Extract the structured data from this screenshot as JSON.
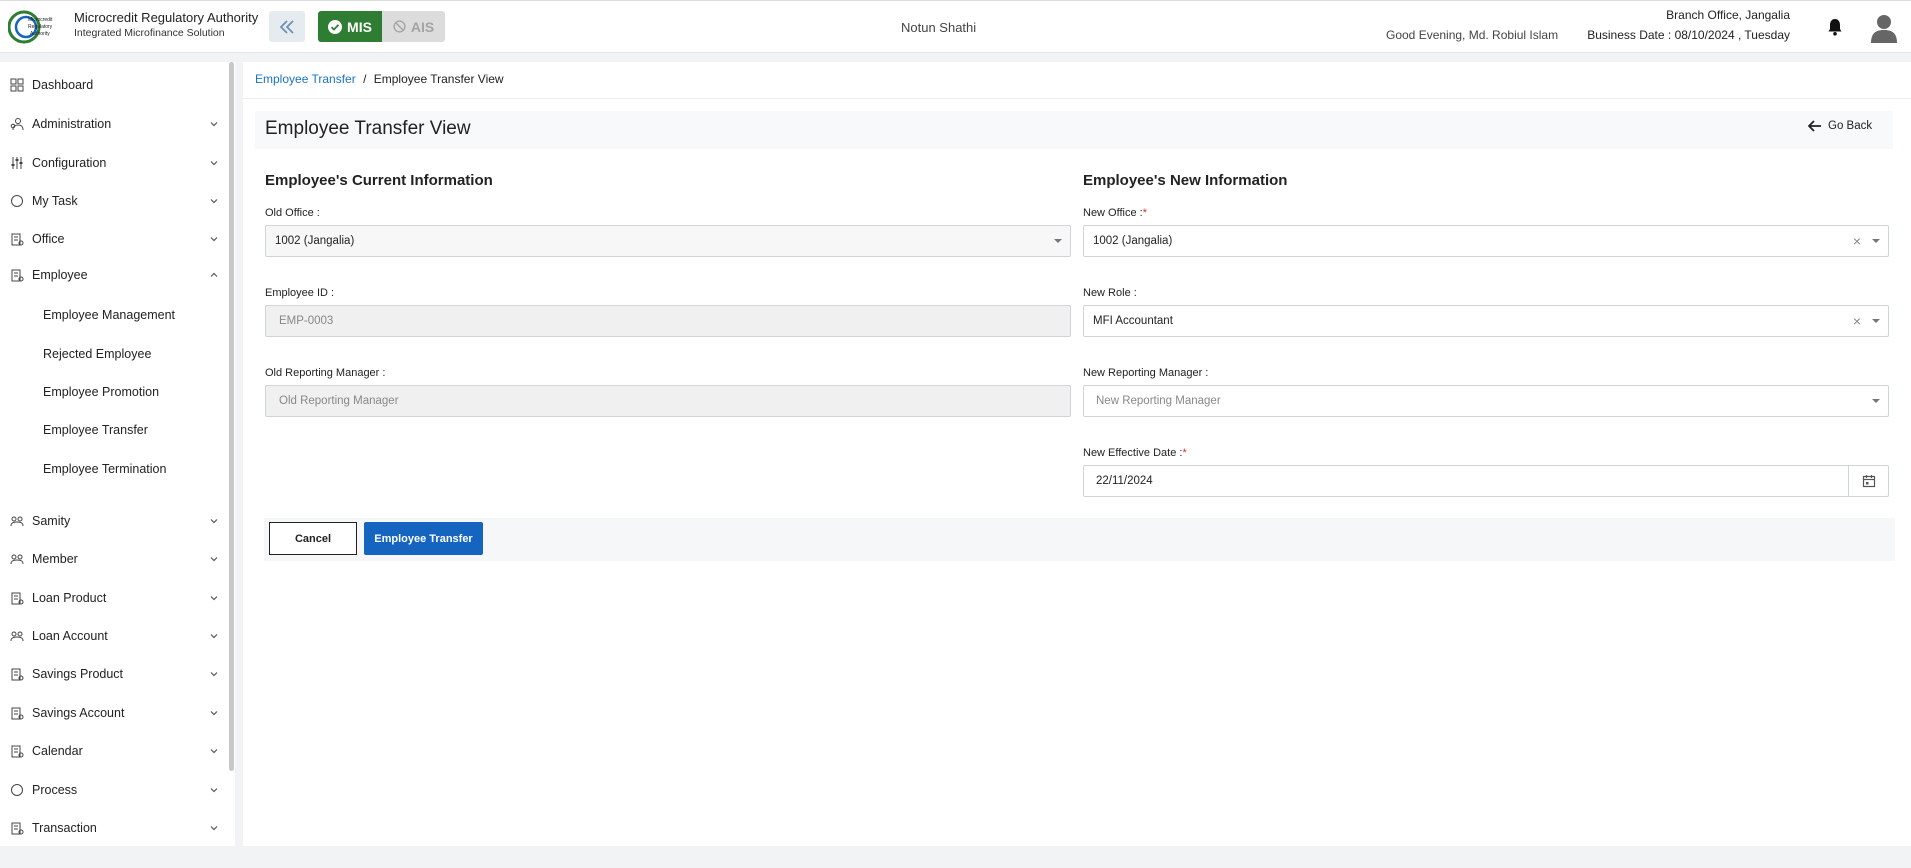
{
  "header": {
    "org_title": "Microcredit Regulatory Authority",
    "org_subtitle": "Integrated Microfinance Solution",
    "logo_text": "Microcredit Regulatory Authority",
    "mis_label": "MIS",
    "ais_label": "AIS",
    "center_title": "Notun Shathi",
    "greeting": "Good Evening, Md. Robiul Islam",
    "branch": "Branch Office, Jangalia",
    "business_date": "Business Date : 08/10/2024 , Tuesday"
  },
  "sidebar": {
    "items": [
      {
        "label": "Dashboard",
        "icon": "dashboard-icon"
      },
      {
        "label": "Administration",
        "icon": "admin-icon"
      },
      {
        "label": "Configuration",
        "icon": "config-icon"
      },
      {
        "label": "My Task",
        "icon": "task-icon"
      },
      {
        "label": "Office",
        "icon": "office-icon"
      },
      {
        "label": "Employee",
        "icon": "employee-icon"
      },
      {
        "label": "Samity",
        "icon": "samity-icon"
      },
      {
        "label": "Member",
        "icon": "member-icon"
      },
      {
        "label": "Loan Product",
        "icon": "loan-product-icon"
      },
      {
        "label": "Loan Account",
        "icon": "loan-account-icon"
      },
      {
        "label": "Savings Product",
        "icon": "savings-product-icon"
      },
      {
        "label": "Savings Account",
        "icon": "savings-account-icon"
      },
      {
        "label": "Calendar",
        "icon": "calendar-icon"
      },
      {
        "label": "Process",
        "icon": "process-icon"
      },
      {
        "label": "Transaction",
        "icon": "transaction-icon"
      }
    ],
    "employee_sub": [
      "Employee Management",
      "Rejected Employee",
      "Employee Promotion",
      "Employee Transfer",
      "Employee Termination"
    ]
  },
  "breadcrumb": {
    "parent": "Employee Transfer",
    "separator": "/",
    "current": "Employee Transfer View"
  },
  "page": {
    "title": "Employee Transfer View",
    "go_back": "Go Back"
  },
  "current_info": {
    "heading": "Employee's Current Information",
    "old_office_label": "Old Office :",
    "old_office_value": "1002 (Jangalia)",
    "employee_id_label": "Employee ID :",
    "employee_id_value": "EMP-0003",
    "old_manager_label": "Old Reporting Manager :",
    "old_manager_placeholder": "Old Reporting Manager"
  },
  "new_info": {
    "heading": "Employee's New Information",
    "new_office_label": "New Office :",
    "new_office_value": "1002 (Jangalia)",
    "new_role_label": "New Role :",
    "new_role_value": "MFI Accountant",
    "new_manager_label": "New Reporting Manager :",
    "new_manager_placeholder": "New Reporting Manager",
    "effective_date_label": "New Effective Date :",
    "effective_date_value": "22/11/2024",
    "required_mark": "*"
  },
  "actions": {
    "cancel": "Cancel",
    "submit": "Employee Transfer"
  },
  "colors": {
    "accent": "#1565c0",
    "mis_green": "#2e7d32",
    "link": "#1a73c8",
    "required": "#d32f2f"
  }
}
